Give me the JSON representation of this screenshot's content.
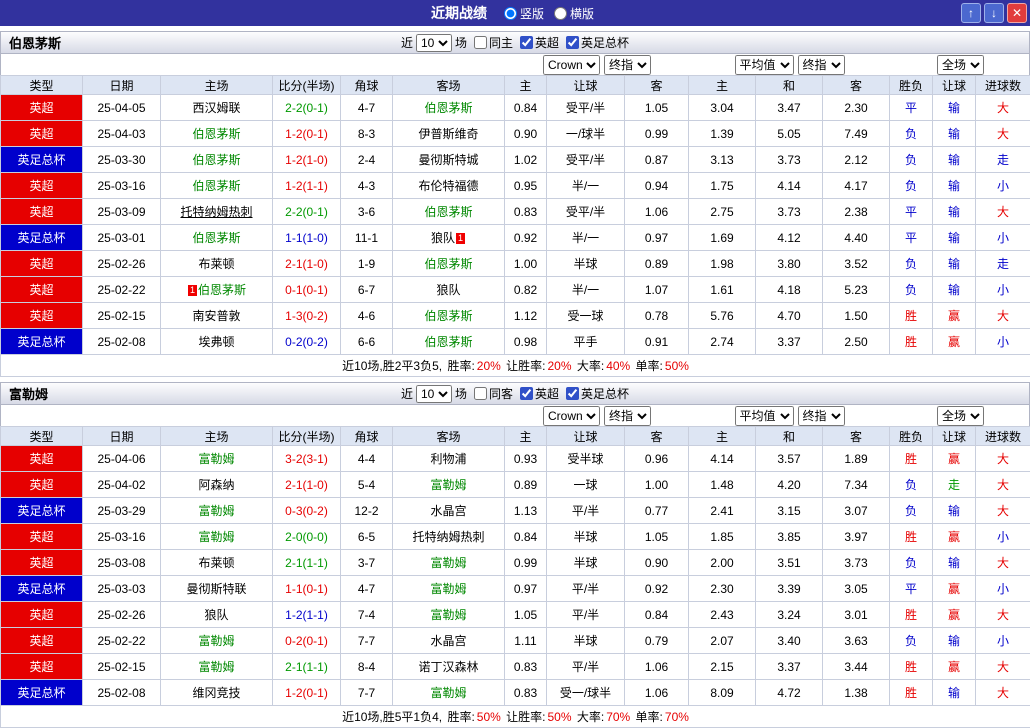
{
  "colors": {
    "titlebar_bg": "#32329e",
    "epl_bg": "#e60000",
    "facup_bg": "#0000cc",
    "team_green": "#008800",
    "res_red": "#e60000",
    "res_blue": "#0000cc",
    "res_green": "#009900",
    "header_bg": "#dde5f3",
    "bar_border": "#b0b4c4"
  },
  "titlebar": {
    "title": "近期战绩",
    "vertical_label": "竖版",
    "horizontal_label": "横版",
    "up_glyph": "↑",
    "down_glyph": "↓",
    "close_glyph": "✕"
  },
  "controls": {
    "near": "近",
    "count": "10",
    "games": "场",
    "epl": "英超",
    "facup": "英足总杯",
    "bookmaker": "Crown",
    "final_odds": "终指",
    "average": "平均值",
    "scope": "全场"
  },
  "headers": {
    "type": "类型",
    "date": "日期",
    "home": "主场",
    "score": "比分(半场)",
    "corner": "角球",
    "away": "客场",
    "ah_home": "主",
    "ah_line": "让球",
    "ah_away": "客",
    "eu_home": "主",
    "eu_draw": "和",
    "eu_away": "客",
    "res_wl": "胜负",
    "res_ah": "让球",
    "res_goal": "进球数"
  },
  "sections": [
    {
      "team": "伯恩茅斯",
      "same_label": "同主",
      "rows": [
        {
          "league": "英超",
          "league_color": "red",
          "date": "25-04-05",
          "home": "西汉姆联",
          "away": "伯恩茅斯",
          "away_green": true,
          "score": "2-2(0-1)",
          "score_color": "green",
          "corner": "4-7",
          "ah_home": "0.84",
          "ah_line": "受平/半",
          "ah_away": "1.05",
          "eu_home": "3.04",
          "eu_draw": "3.47",
          "eu_away": "2.30",
          "res_wl": "平",
          "res_wl_color": "blue",
          "res_ah": "输",
          "res_ah_color": "blue",
          "res_goal": "大",
          "res_goal_color": "red"
        },
        {
          "league": "英超",
          "league_color": "red",
          "date": "25-04-03",
          "home": "伯恩茅斯",
          "home_green": true,
          "away": "伊普斯维奇",
          "score": "1-2(0-1)",
          "score_color": "red",
          "corner": "8-3",
          "ah_home": "0.90",
          "ah_line": "一/球半",
          "ah_away": "0.99",
          "eu_home": "1.39",
          "eu_draw": "5.05",
          "eu_away": "7.49",
          "res_wl": "负",
          "res_wl_color": "blue",
          "res_ah": "输",
          "res_ah_color": "blue",
          "res_goal": "大",
          "res_goal_color": "red"
        },
        {
          "league": "英足总杯",
          "league_color": "blue",
          "date": "25-03-30",
          "home": "伯恩茅斯",
          "home_green": true,
          "away": "曼彻斯特城",
          "score": "1-2(1-0)",
          "score_color": "red",
          "corner": "2-4",
          "ah_home": "1.02",
          "ah_line": "受平/半",
          "ah_away": "0.87",
          "eu_home": "3.13",
          "eu_draw": "3.73",
          "eu_away": "2.12",
          "res_wl": "负",
          "res_wl_color": "blue",
          "res_ah": "输",
          "res_ah_color": "blue",
          "res_goal": "走",
          "res_goal_color": "blue"
        },
        {
          "league": "英超",
          "league_color": "red",
          "date": "25-03-16",
          "home": "伯恩茅斯",
          "home_green": true,
          "away": "布伦特福德",
          "score": "1-2(1-1)",
          "score_color": "red",
          "corner": "4-3",
          "ah_home": "0.95",
          "ah_line": "半/一",
          "ah_away": "0.94",
          "eu_home": "1.75",
          "eu_draw": "4.14",
          "eu_away": "4.17",
          "res_wl": "负",
          "res_wl_color": "blue",
          "res_ah": "输",
          "res_ah_color": "blue",
          "res_goal": "小",
          "res_goal_color": "blue"
        },
        {
          "league": "英超",
          "league_color": "red",
          "date": "25-03-09",
          "home": "托特纳姆热刺",
          "home_underline": true,
          "away": "伯恩茅斯",
          "away_green": true,
          "score": "2-2(0-1)",
          "score_color": "green",
          "corner": "3-6",
          "ah_home": "0.83",
          "ah_line": "受平/半",
          "ah_away": "1.06",
          "eu_home": "2.75",
          "eu_draw": "3.73",
          "eu_away": "2.38",
          "res_wl": "平",
          "res_wl_color": "blue",
          "res_ah": "输",
          "res_ah_color": "blue",
          "res_goal": "大",
          "res_goal_color": "red"
        },
        {
          "league": "英足总杯",
          "league_color": "blue",
          "date": "25-03-01",
          "home": "伯恩茅斯",
          "home_green": true,
          "away": "狼队",
          "away_card": "1",
          "score": "1-1(1-0)",
          "score_color": "blue",
          "corner": "11-1",
          "ah_home": "0.92",
          "ah_line": "半/一",
          "ah_away": "0.97",
          "eu_home": "1.69",
          "eu_draw": "4.12",
          "eu_away": "4.40",
          "res_wl": "平",
          "res_wl_color": "blue",
          "res_ah": "输",
          "res_ah_color": "blue",
          "res_goal": "小",
          "res_goal_color": "blue"
        },
        {
          "league": "英超",
          "league_color": "red",
          "date": "25-02-26",
          "home": "布莱顿",
          "away": "伯恩茅斯",
          "away_green": true,
          "score": "2-1(1-0)",
          "score_color": "red",
          "corner": "1-9",
          "ah_home": "1.00",
          "ah_line": "半球",
          "ah_away": "0.89",
          "eu_home": "1.98",
          "eu_draw": "3.80",
          "eu_away": "3.52",
          "res_wl": "负",
          "res_wl_color": "blue",
          "res_ah": "输",
          "res_ah_color": "blue",
          "res_goal": "走",
          "res_goal_color": "blue"
        },
        {
          "league": "英超",
          "league_color": "red",
          "date": "25-02-22",
          "home": "伯恩茅斯",
          "home_green": true,
          "home_card": "1",
          "away": "狼队",
          "score": "0-1(0-1)",
          "score_color": "red",
          "corner": "6-7",
          "ah_home": "0.82",
          "ah_line": "半/一",
          "ah_away": "1.07",
          "eu_home": "1.61",
          "eu_draw": "4.18",
          "eu_away": "5.23",
          "res_wl": "负",
          "res_wl_color": "blue",
          "res_ah": "输",
          "res_ah_color": "blue",
          "res_goal": "小",
          "res_goal_color": "blue"
        },
        {
          "league": "英超",
          "league_color": "red",
          "date": "25-02-15",
          "home": "南安普敦",
          "away": "伯恩茅斯",
          "away_green": true,
          "score": "1-3(0-2)",
          "score_color": "red",
          "corner": "4-6",
          "ah_home": "1.12",
          "ah_line": "受一球",
          "ah_away": "0.78",
          "eu_home": "5.76",
          "eu_draw": "4.70",
          "eu_away": "1.50",
          "res_wl": "胜",
          "res_wl_color": "red",
          "res_ah": "赢",
          "res_ah_color": "red",
          "res_goal": "大",
          "res_goal_color": "red"
        },
        {
          "league": "英足总杯",
          "league_color": "blue",
          "date": "25-02-08",
          "home": "埃弗顿",
          "away": "伯恩茅斯",
          "away_green": true,
          "score": "0-2(0-2)",
          "score_color": "blue",
          "corner": "6-6",
          "ah_home": "0.98",
          "ah_line": "平手",
          "ah_away": "0.91",
          "eu_home": "2.74",
          "eu_draw": "3.37",
          "eu_away": "2.50",
          "res_wl": "胜",
          "res_wl_color": "red",
          "res_ah": "赢",
          "res_ah_color": "red",
          "res_goal": "小",
          "res_goal_color": "blue"
        }
      ],
      "summary": {
        "lead": "近10场,胜2平3负5,",
        "stats": [
          {
            "label": "胜率:",
            "value": "20%"
          },
          {
            "label": "让胜率:",
            "value": "20%"
          },
          {
            "label": "大率:",
            "value": "40%"
          },
          {
            "label": "单率:",
            "value": "50%"
          }
        ]
      }
    },
    {
      "team": "富勒姆",
      "same_label": "同客",
      "rows": [
        {
          "league": "英超",
          "league_color": "red",
          "date": "25-04-06",
          "home": "富勒姆",
          "home_green": true,
          "away": "利物浦",
          "score": "3-2(3-1)",
          "score_color": "red",
          "corner": "4-4",
          "ah_home": "0.93",
          "ah_line": "受半球",
          "ah_away": "0.96",
          "eu_home": "4.14",
          "eu_draw": "3.57",
          "eu_away": "1.89",
          "res_wl": "胜",
          "res_wl_color": "red",
          "res_ah": "赢",
          "res_ah_color": "red",
          "res_goal": "大",
          "res_goal_color": "red"
        },
        {
          "league": "英超",
          "league_color": "red",
          "date": "25-04-02",
          "home": "阿森纳",
          "away": "富勒姆",
          "away_green": true,
          "score": "2-1(1-0)",
          "score_color": "red",
          "corner": "5-4",
          "ah_home": "0.89",
          "ah_line": "一球",
          "ah_away": "1.00",
          "eu_home": "1.48",
          "eu_draw": "4.20",
          "eu_away": "7.34",
          "res_wl": "负",
          "res_wl_color": "blue",
          "res_ah": "走",
          "res_ah_color": "green",
          "res_goal": "大",
          "res_goal_color": "red"
        },
        {
          "league": "英足总杯",
          "league_color": "blue",
          "date": "25-03-29",
          "home": "富勒姆",
          "home_green": true,
          "away": "水晶宫",
          "score": "0-3(0-2)",
          "score_color": "red",
          "corner": "12-2",
          "ah_home": "1.13",
          "ah_line": "平/半",
          "ah_away": "0.77",
          "eu_home": "2.41",
          "eu_draw": "3.15",
          "eu_away": "3.07",
          "res_wl": "负",
          "res_wl_color": "blue",
          "res_ah": "输",
          "res_ah_color": "blue",
          "res_goal": "大",
          "res_goal_color": "red"
        },
        {
          "league": "英超",
          "league_color": "red",
          "date": "25-03-16",
          "home": "富勒姆",
          "home_green": true,
          "away": "托特纳姆热刺",
          "score": "2-0(0-0)",
          "score_color": "green",
          "corner": "6-5",
          "ah_home": "0.84",
          "ah_line": "半球",
          "ah_away": "1.05",
          "eu_home": "1.85",
          "eu_draw": "3.85",
          "eu_away": "3.97",
          "res_wl": "胜",
          "res_wl_color": "red",
          "res_ah": "赢",
          "res_ah_color": "red",
          "res_goal": "小",
          "res_goal_color": "blue"
        },
        {
          "league": "英超",
          "league_color": "red",
          "date": "25-03-08",
          "home": "布莱顿",
          "away": "富勒姆",
          "away_green": true,
          "score": "2-1(1-1)",
          "score_color": "green",
          "corner": "3-7",
          "ah_home": "0.99",
          "ah_line": "半球",
          "ah_away": "0.90",
          "eu_home": "2.00",
          "eu_draw": "3.51",
          "eu_away": "3.73",
          "res_wl": "负",
          "res_wl_color": "blue",
          "res_ah": "输",
          "res_ah_color": "blue",
          "res_goal": "大",
          "res_goal_color": "red"
        },
        {
          "league": "英足总杯",
          "league_color": "blue",
          "date": "25-03-03",
          "home": "曼彻斯特联",
          "away": "富勒姆",
          "away_green": true,
          "score": "1-1(0-1)",
          "score_color": "red",
          "corner": "4-7",
          "ah_home": "0.97",
          "ah_line": "平/半",
          "ah_away": "0.92",
          "eu_home": "2.30",
          "eu_draw": "3.39",
          "eu_away": "3.05",
          "res_wl": "平",
          "res_wl_color": "blue",
          "res_ah": "赢",
          "res_ah_color": "red",
          "res_goal": "小",
          "res_goal_color": "blue"
        },
        {
          "league": "英超",
          "league_color": "red",
          "date": "25-02-26",
          "home": "狼队",
          "away": "富勒姆",
          "away_green": true,
          "score": "1-2(1-1)",
          "score_color": "blue",
          "corner": "7-4",
          "ah_home": "1.05",
          "ah_line": "平/半",
          "ah_away": "0.84",
          "eu_home": "2.43",
          "eu_draw": "3.24",
          "eu_away": "3.01",
          "res_wl": "胜",
          "res_wl_color": "red",
          "res_ah": "赢",
          "res_ah_color": "red",
          "res_goal": "大",
          "res_goal_color": "red"
        },
        {
          "league": "英超",
          "league_color": "red",
          "date": "25-02-22",
          "home": "富勒姆",
          "home_green": true,
          "away": "水晶宫",
          "score": "0-2(0-1)",
          "score_color": "red",
          "corner": "7-7",
          "ah_home": "1.11",
          "ah_line": "半球",
          "ah_away": "0.79",
          "eu_home": "2.07",
          "eu_draw": "3.40",
          "eu_away": "3.63",
          "res_wl": "负",
          "res_wl_color": "blue",
          "res_ah": "输",
          "res_ah_color": "blue",
          "res_goal": "小",
          "res_goal_color": "blue"
        },
        {
          "league": "英超",
          "league_color": "red",
          "date": "25-02-15",
          "home": "富勒姆",
          "home_green": true,
          "away": "诺丁汉森林",
          "score": "2-1(1-1)",
          "score_color": "green",
          "corner": "8-4",
          "ah_home": "0.83",
          "ah_line": "平/半",
          "ah_away": "1.06",
          "eu_home": "2.15",
          "eu_draw": "3.37",
          "eu_away": "3.44",
          "res_wl": "胜",
          "res_wl_color": "red",
          "res_ah": "赢",
          "res_ah_color": "red",
          "res_goal": "大",
          "res_goal_color": "red"
        },
        {
          "league": "英足总杯",
          "league_color": "blue",
          "date": "25-02-08",
          "home": "维冈竞技",
          "away": "富勒姆",
          "away_green": true,
          "score": "1-2(0-1)",
          "score_color": "red",
          "corner": "7-7",
          "ah_home": "0.83",
          "ah_line": "受一/球半",
          "ah_away": "1.06",
          "eu_home": "8.09",
          "eu_draw": "4.72",
          "eu_away": "1.38",
          "res_wl": "胜",
          "res_wl_color": "red",
          "res_ah": "输",
          "res_ah_color": "blue",
          "res_goal": "大",
          "res_goal_color": "red"
        }
      ],
      "summary": {
        "lead": "近10场,胜5平1负4,",
        "stats": [
          {
            "label": "胜率:",
            "value": "50%"
          },
          {
            "label": "让胜率:",
            "value": "50%"
          },
          {
            "label": "大率:",
            "value": "70%"
          },
          {
            "label": "单率:",
            "value": "70%"
          }
        ]
      }
    }
  ]
}
